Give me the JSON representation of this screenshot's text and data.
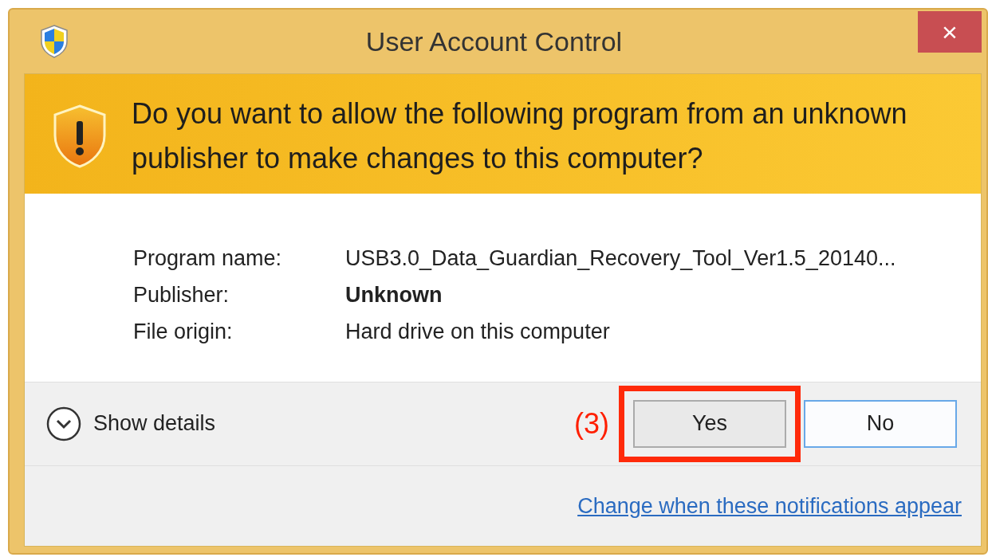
{
  "window": {
    "title": "User Account Control",
    "close": "×"
  },
  "header": {
    "question": "Do you want to allow the following program from an unknown publisher to make changes to this computer?"
  },
  "details": [
    {
      "label": "Program name:",
      "value": "USB3.0_Data_Guardian_Recovery_Tool_Ver1.5_20140...",
      "bold": false
    },
    {
      "label": "Publisher:",
      "value": "Unknown",
      "bold": true
    },
    {
      "label": "File origin:",
      "value": "Hard drive on this computer",
      "bold": false
    }
  ],
  "show_details": {
    "label": "Show details",
    "expanded": false
  },
  "annotation": {
    "label": "(3)"
  },
  "buttons": [
    {
      "label": "Yes",
      "focused": false,
      "highlighted": true
    },
    {
      "label": "No",
      "focused": true,
      "highlighted": false
    }
  ],
  "link": "Change when these notifications appear"
}
